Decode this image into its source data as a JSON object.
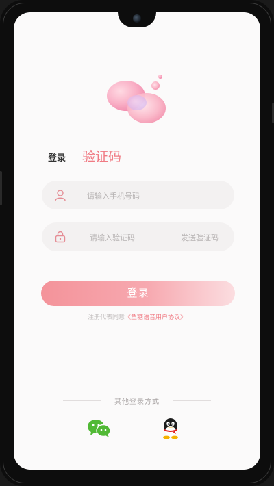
{
  "tabs": {
    "login": "登录",
    "verification_code": "验证码"
  },
  "phone_field": {
    "placeholder": "请输入手机号码",
    "icon": "person-icon"
  },
  "code_field": {
    "placeholder": "请输入验证码",
    "icon": "lock-icon",
    "send_code": "发送验证码"
  },
  "login_button": {
    "label": "登录"
  },
  "agreement": {
    "prefix": "注册代表同意",
    "link": "《鱼糖语音用户协议》"
  },
  "other_login": {
    "label": "其他登录方式",
    "wechat_icon": "wechat-icon",
    "qq_icon": "qq-icon"
  },
  "colors": {
    "accent": "#f07a83",
    "button_start": "#f4939a",
    "button_end": "#fbdde0",
    "field_bg": "#f3f1f1"
  }
}
